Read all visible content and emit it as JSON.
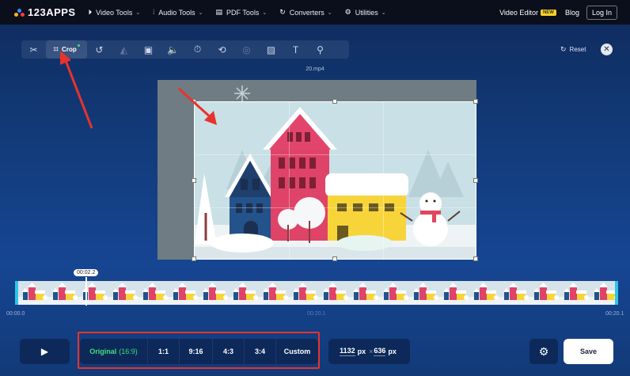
{
  "nav": {
    "logo_text": "123APPS",
    "items": [
      {
        "label": "Video Tools",
        "icon": "play-circle-icon"
      },
      {
        "label": "Audio Tools",
        "icon": "waveform-icon"
      },
      {
        "label": "PDF Tools",
        "icon": "document-icon"
      },
      {
        "label": "Converters",
        "icon": "refresh-icon"
      },
      {
        "label": "Utilities",
        "icon": "gear-icon"
      }
    ],
    "video_editor": "Video Editor",
    "new_badge": "NEW",
    "blog": "Blog",
    "login": "Log In"
  },
  "toolbar": {
    "crop_label": "Crop",
    "tools": [
      "scissors-icon",
      "crop-icon",
      "rotate-icon",
      "flip-icon",
      "resize-icon",
      "volume-icon",
      "speed-icon",
      "loop-icon",
      "stabilize-icon",
      "image-icon",
      "text-icon",
      "remove-logo-icon"
    ],
    "reset_label": "Reset"
  },
  "video": {
    "filename": "20.mp4"
  },
  "timeline": {
    "current_time": "00:02.2",
    "start_time": "00:00.0",
    "mid_time": "00:20.1",
    "end_time": "00:20.1"
  },
  "bottom": {
    "ratios": [
      {
        "label": "Original",
        "sub": "(16:9)"
      },
      {
        "label": "1:1",
        "sub": ""
      },
      {
        "label": "9:16",
        "sub": ""
      },
      {
        "label": "4:3",
        "sub": ""
      },
      {
        "label": "3:4",
        "sub": ""
      },
      {
        "label": "Custom",
        "sub": ""
      }
    ],
    "width_value": "1132",
    "height_value": "636",
    "unit": "px",
    "save_label": "Save"
  },
  "colors": {
    "accent_green": "#3fe07a",
    "highlight_red": "#e8332c",
    "timeline_cyan": "#2ec5e8"
  }
}
